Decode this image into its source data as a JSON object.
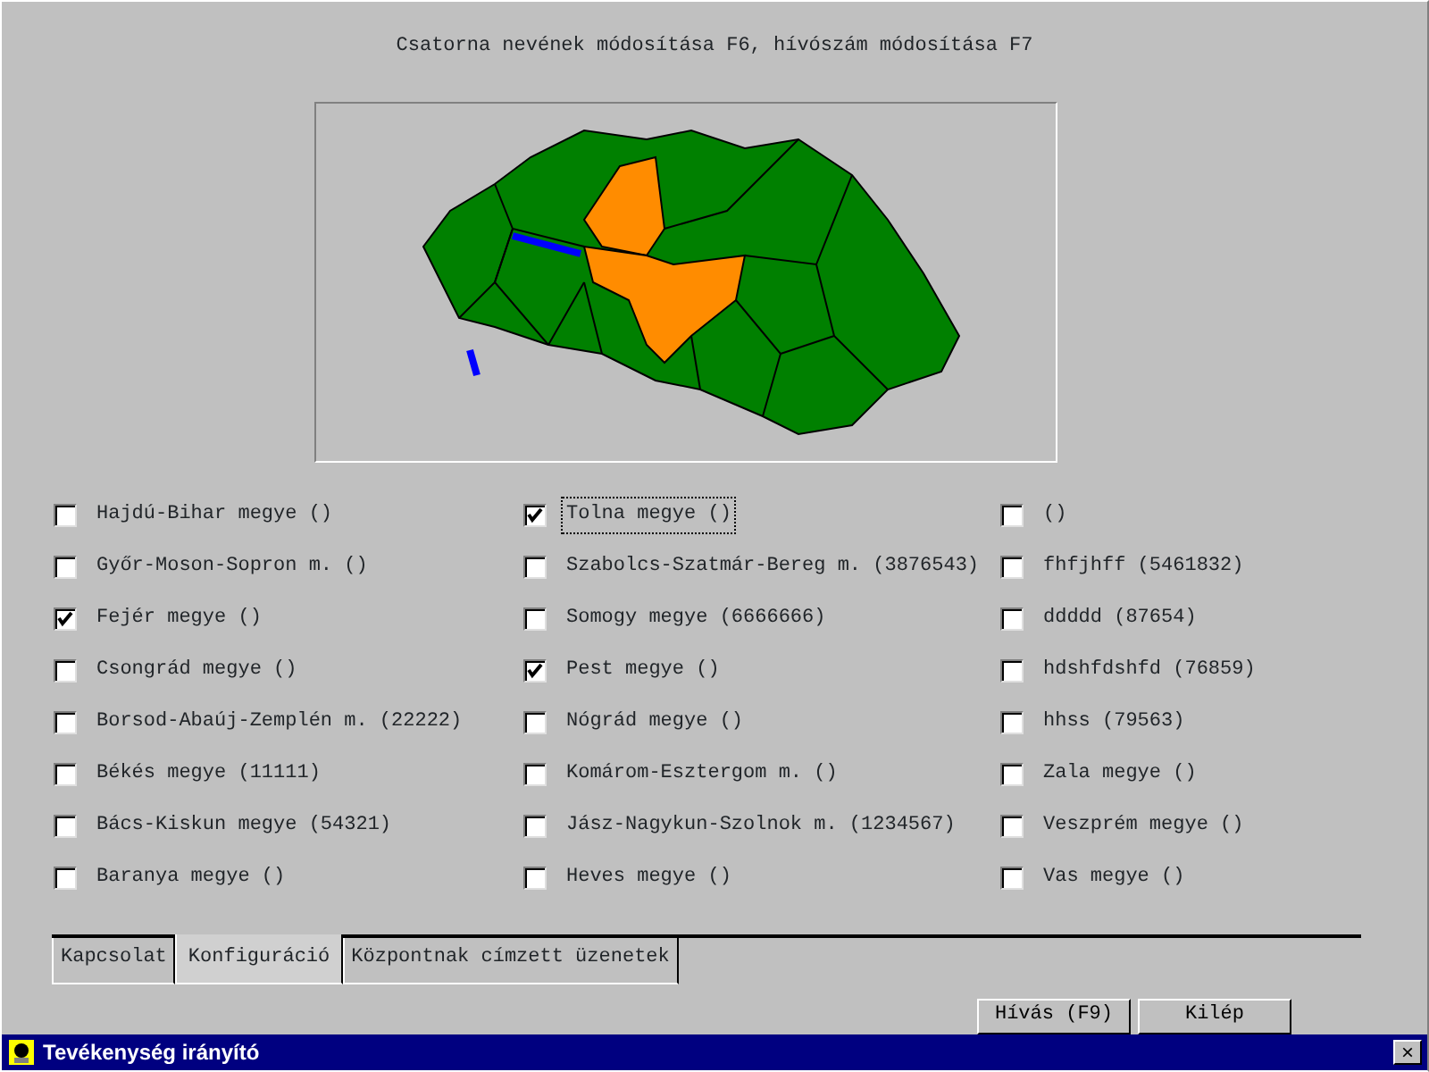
{
  "header": "Csatorna nevének módosítása F6, hívószám módosítása F7",
  "columns": [
    [
      {
        "label": "Hajdú-Bihar megye ()",
        "checked": false,
        "focused": false
      },
      {
        "label": "Győr-Moson-Sopron m. ()",
        "checked": false,
        "focused": false
      },
      {
        "label": "Fejér megye ()",
        "checked": true,
        "focused": false
      },
      {
        "label": "Csongrád megye ()",
        "checked": false,
        "focused": false
      },
      {
        "label": "Borsod-Abaúj-Zemplén m. (22222)",
        "checked": false,
        "focused": false
      },
      {
        "label": "Békés megye (11111)",
        "checked": false,
        "focused": false
      },
      {
        "label": "Bács-Kiskun megye (54321)",
        "checked": false,
        "focused": false
      },
      {
        "label": "Baranya megye ()",
        "checked": false,
        "focused": false
      }
    ],
    [
      {
        "label": "Tolna megye ()",
        "checked": true,
        "focused": true
      },
      {
        "label": "Szabolcs-Szatmár-Bereg m. (3876543)",
        "checked": false,
        "focused": false
      },
      {
        "label": "Somogy megye (6666666)",
        "checked": false,
        "focused": false
      },
      {
        "label": "Pest megye ()",
        "checked": true,
        "focused": false
      },
      {
        "label": "Nógrád megye ()",
        "checked": false,
        "focused": false
      },
      {
        "label": "Komárom-Esztergom m. ()",
        "checked": false,
        "focused": false
      },
      {
        "label": "Jász-Nagykun-Szolnok m. (1234567)",
        "checked": false,
        "focused": false
      },
      {
        "label": "Heves megye ()",
        "checked": false,
        "focused": false
      }
    ],
    [
      {
        "label": "()",
        "checked": false,
        "focused": false
      },
      {
        "label": "fhfjhff (5461832)",
        "checked": false,
        "focused": false
      },
      {
        "label": "ddddd (87654)",
        "checked": false,
        "focused": false
      },
      {
        "label": "hdshfdshfd (76859)",
        "checked": false,
        "focused": false
      },
      {
        "label": "hhss (79563)",
        "checked": false,
        "focused": false
      },
      {
        "label": "Zala megye ()",
        "checked": false,
        "focused": false
      },
      {
        "label": "Veszprém megye ()",
        "checked": false,
        "focused": false
      },
      {
        "label": "Vas megye ()",
        "checked": false,
        "focused": false
      }
    ]
  ],
  "tabs": [
    {
      "label": "Kapcsolat",
      "selected": false
    },
    {
      "label": "Konfiguráció",
      "selected": true
    },
    {
      "label": "Központnak címzett üzenetek",
      "selected": false
    }
  ],
  "buttons": [
    "Hívás (F9)",
    "Kilép"
  ],
  "window": {
    "title": "Tevékenység irányító",
    "close": "×"
  }
}
